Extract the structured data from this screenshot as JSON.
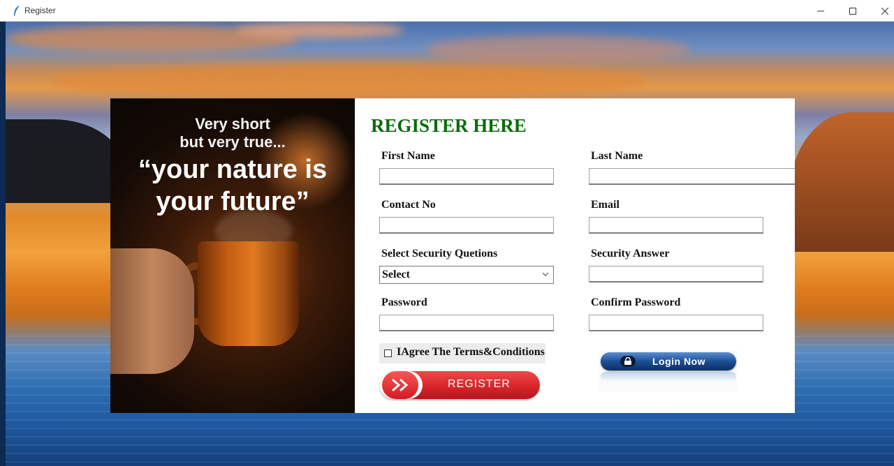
{
  "window": {
    "title": "Register",
    "controls": {
      "minimize": "minimize-icon",
      "maximize": "maximize-icon",
      "close": "close-icon"
    }
  },
  "promo": {
    "line1": "Very short",
    "line2": "but very true...",
    "quote_line1": "“your nature is",
    "quote_line2": "your future”"
  },
  "form": {
    "title": "REGISTER HERE",
    "first_name": {
      "label": "First Name",
      "value": ""
    },
    "last_name": {
      "label": "Last Name",
      "value": ""
    },
    "contact_no": {
      "label": "Contact No",
      "value": ""
    },
    "email": {
      "label": "Email",
      "value": ""
    },
    "security_question": {
      "label": "Select Security Quetions",
      "selected": "Select"
    },
    "security_answer": {
      "label": "Security Answer",
      "value": ""
    },
    "password": {
      "label": "Password",
      "value": ""
    },
    "confirm_password": {
      "label": "Confirm Password",
      "value": ""
    },
    "agree": {
      "label": "IAgree The Terms&Conditions",
      "checked": false
    },
    "register_button": "REGISTER",
    "login_button": "Login Now"
  },
  "colors": {
    "title_green": "#0a6b0a",
    "register_red": "#d8262b",
    "login_blue": "#1d4f96"
  }
}
